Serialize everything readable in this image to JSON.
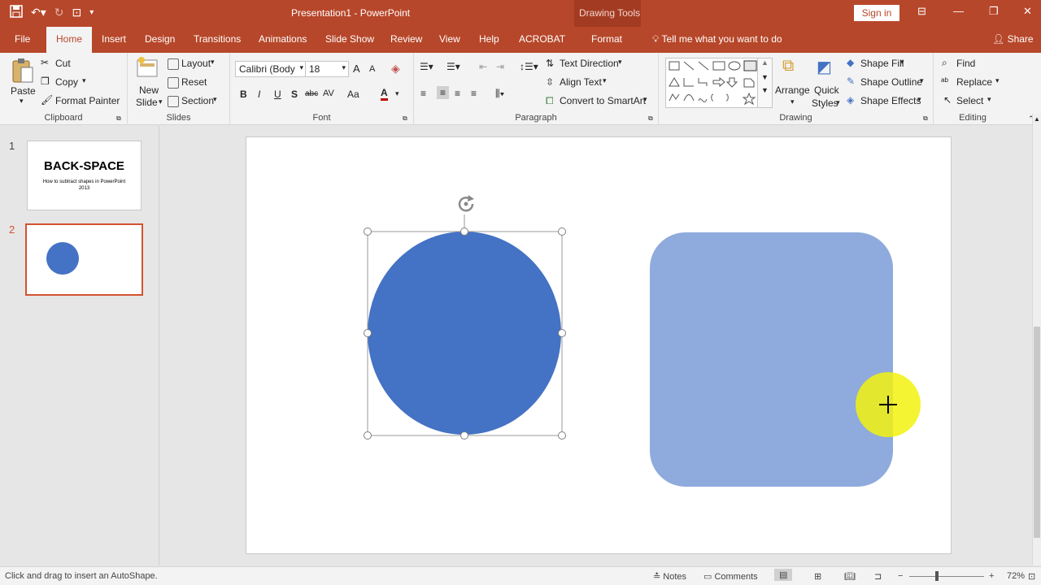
{
  "titlebar": {
    "doc_title": "Presentation1 - PowerPoint",
    "contextual_tab": "Drawing Tools",
    "sign_in": "Sign in"
  },
  "tabs": [
    "File",
    "Home",
    "Insert",
    "Design",
    "Transitions",
    "Animations",
    "Slide Show",
    "Review",
    "View",
    "Help",
    "ACROBAT",
    "Format"
  ],
  "tell_me": "Tell me what you want to do",
  "share": "Share",
  "ribbon": {
    "clipboard": {
      "paste": "Paste",
      "cut": "Cut",
      "copy": "Copy",
      "format_painter": "Format Painter",
      "label": "Clipboard"
    },
    "slides": {
      "new_slide_1": "New",
      "new_slide_2": "Slide",
      "layout": "Layout",
      "reset": "Reset",
      "section": "Section",
      "label": "Slides"
    },
    "font": {
      "family": "Calibri (Body",
      "size": "18",
      "bold": "B",
      "italic": "I",
      "underline": "U",
      "shadow": "S",
      "strike": "abc",
      "spacing": "AV",
      "case": "Aa",
      "color": "A",
      "grow": "A",
      "shrink": "A",
      "label": "Font"
    },
    "paragraph": {
      "text_direction": "Text Direction",
      "align_text": "Align Text",
      "convert_smartart": "Convert to SmartArt",
      "label": "Paragraph"
    },
    "drawing": {
      "arrange": "Arrange",
      "quick_styles_1": "Quick",
      "quick_styles_2": "Styles",
      "shape_fill": "Shape Fill",
      "shape_outline": "Shape Outline",
      "shape_effects": "Shape Effects",
      "label": "Drawing"
    },
    "editing": {
      "find": "Find",
      "replace": "Replace",
      "select": "Select",
      "label": "Editing"
    }
  },
  "slides_panel": [
    {
      "number": "1",
      "title": "BACK-SPACE",
      "subtitle": "How to subtract shapes in PowerPoint 2013"
    },
    {
      "number": "2"
    }
  ],
  "colors": {
    "accent": "#b7472a",
    "circle_fill": "#4472c4",
    "roundrect_fill": "#8faadc",
    "cursor_highlight": "#f2f20f"
  },
  "statusbar": {
    "message": "Click and drag to insert an AutoShape.",
    "notes": "Notes",
    "comments": "Comments",
    "zoom": "72%"
  }
}
